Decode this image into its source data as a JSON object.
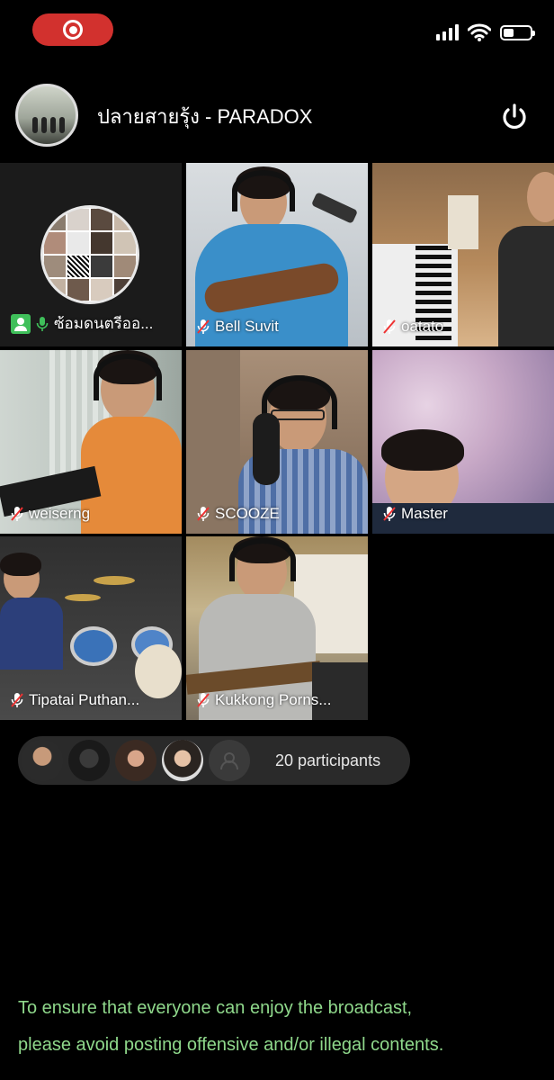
{
  "status_bar": {
    "recording_icon": "record-icon",
    "signal_icon": "signal-icon",
    "wifi_icon": "wifi-icon",
    "battery_icon": "battery-icon"
  },
  "header": {
    "title": "ปลายสายรุ้ง - PARADOX",
    "power_icon": "power-icon"
  },
  "tiles": [
    {
      "name": "ซ้อมดนตรีออ...",
      "role": "host"
    },
    {
      "name": "Bell Suvit"
    },
    {
      "name": "oatato"
    },
    {
      "name": "weiserng"
    },
    {
      "name": "SCOOZE"
    },
    {
      "name": "Master"
    },
    {
      "name": "Tipatai Puthan..."
    },
    {
      "name": "Kukkong Porns..."
    }
  ],
  "participants": {
    "count_label": "20 participants"
  },
  "notice": {
    "line1": "To ensure that everyone can enjoy the broadcast,",
    "line2": "please avoid posting offensive and/or illegal contents."
  },
  "colors": {
    "record": "#d2312e",
    "host_badge": "#3fbf5a",
    "notice_text": "#8fd88b"
  }
}
